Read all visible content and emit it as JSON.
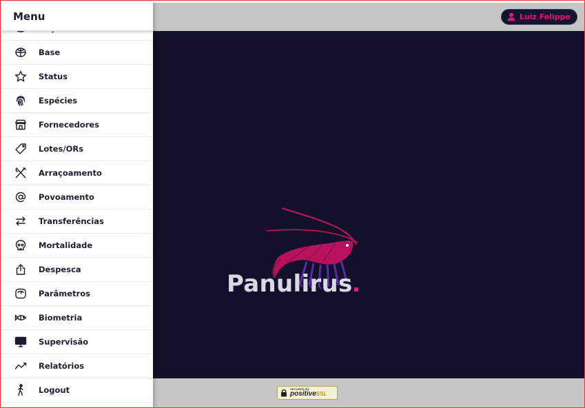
{
  "menu": {
    "title": "Menu",
    "items": [
      {
        "label": "Ração",
        "icon": "feed-icon"
      },
      {
        "label": "Base",
        "icon": "globe-icon"
      },
      {
        "label": "Status",
        "icon": "star-icon"
      },
      {
        "label": "Espécies",
        "icon": "fingerprint-icon"
      },
      {
        "label": "Fornecedores",
        "icon": "store-icon"
      },
      {
        "label": "Lotes/ORs",
        "icon": "tag-icon"
      },
      {
        "label": "Arraçoamento",
        "icon": "utensils-icon"
      },
      {
        "label": "Povoamento",
        "icon": "at-icon"
      },
      {
        "label": "Transferências",
        "icon": "transfer-arrows-icon"
      },
      {
        "label": "Mortalidade",
        "icon": "skull-icon"
      },
      {
        "label": "Despesca",
        "icon": "upload-icon"
      },
      {
        "label": "Parâmetros",
        "icon": "gauge-icon"
      },
      {
        "label": "Biometria",
        "icon": "fish-icon"
      },
      {
        "label": "Supervisão",
        "icon": "monitor-icon"
      },
      {
        "label": "Relatórios",
        "icon": "trend-icon"
      },
      {
        "label": "Logout",
        "icon": "walking-person-icon"
      }
    ]
  },
  "header": {
    "user_name": "Luiz Felippe"
  },
  "main": {
    "logo_text": "Panulirus"
  },
  "footer": {
    "ssl_small": "SECURED BY",
    "ssl_brand": "positive",
    "ssl_suffix": "SSL"
  },
  "colors": {
    "accent": "#e0177a",
    "background_dark": "#11112c",
    "bar_gray": "#c6c6c6"
  }
}
